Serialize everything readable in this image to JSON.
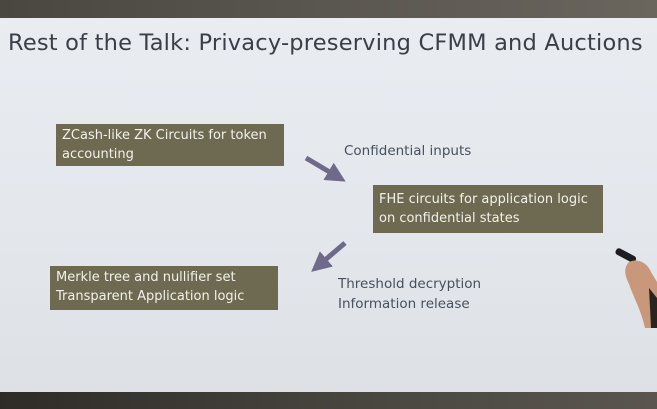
{
  "slide": {
    "title": "Rest of the Talk: Privacy-preserving CFMM and Auctions"
  },
  "boxes": {
    "zk": {
      "line1": "ZCash-like ZK Circuits for token",
      "line2": "accounting"
    },
    "fhe": {
      "line1": "FHE circuits for application logic",
      "line2": "on confidential states"
    },
    "merkle": {
      "line1": "Merkle tree and nullifier set",
      "line2": "Transparent Application logic"
    }
  },
  "labels": {
    "confidential": "Confidential inputs",
    "threshold_line1": "Threshold decryption",
    "threshold_line2": "Information release"
  },
  "colors": {
    "box_fill": "#6e6a52",
    "arrow": "#6f6a8a",
    "title_text": "#3a3f47"
  }
}
